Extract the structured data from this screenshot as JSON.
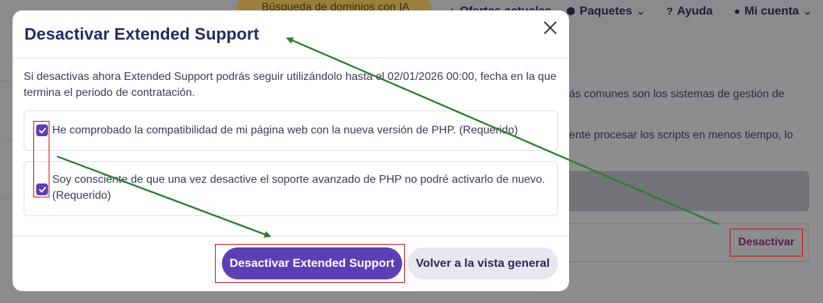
{
  "background": {
    "nav": {
      "promo_label": "Búsqueda de dominios con IA",
      "offers_label": "Ofertas actuales",
      "packages_label": "Paquetes",
      "help_label": "Ayuda",
      "account_label": "Mi cuenta"
    },
    "text_line_1": "ás comunes son los sistemas de gestión de",
    "text_line_2": "ente procesar los scripts en menos tiempo, lo",
    "deactivate_label": "Desactivar"
  },
  "modal": {
    "title": "Desactivar Extended Support",
    "intro": "Si desactivas ahora Extended Support podrás seguir utilizándolo hasta el 02/01/2026 00:00, fecha en la que termina el periodo de contratación.",
    "check_1": "He comprobado la compatibilidad de mi página web con la nueva versión de PHP. (Requerido)",
    "check_2": "Soy consciente de que una vez desactive el soporte avanzado de PHP no podré activarlo de nuevo. (Requerido)",
    "primary_button": "Desactivar Extended Support",
    "secondary_button": "Volver a la vista general"
  },
  "colors": {
    "accent": "#5d3fb5",
    "annotation_red": "#d00000",
    "annotation_green": "#2e7d32"
  }
}
